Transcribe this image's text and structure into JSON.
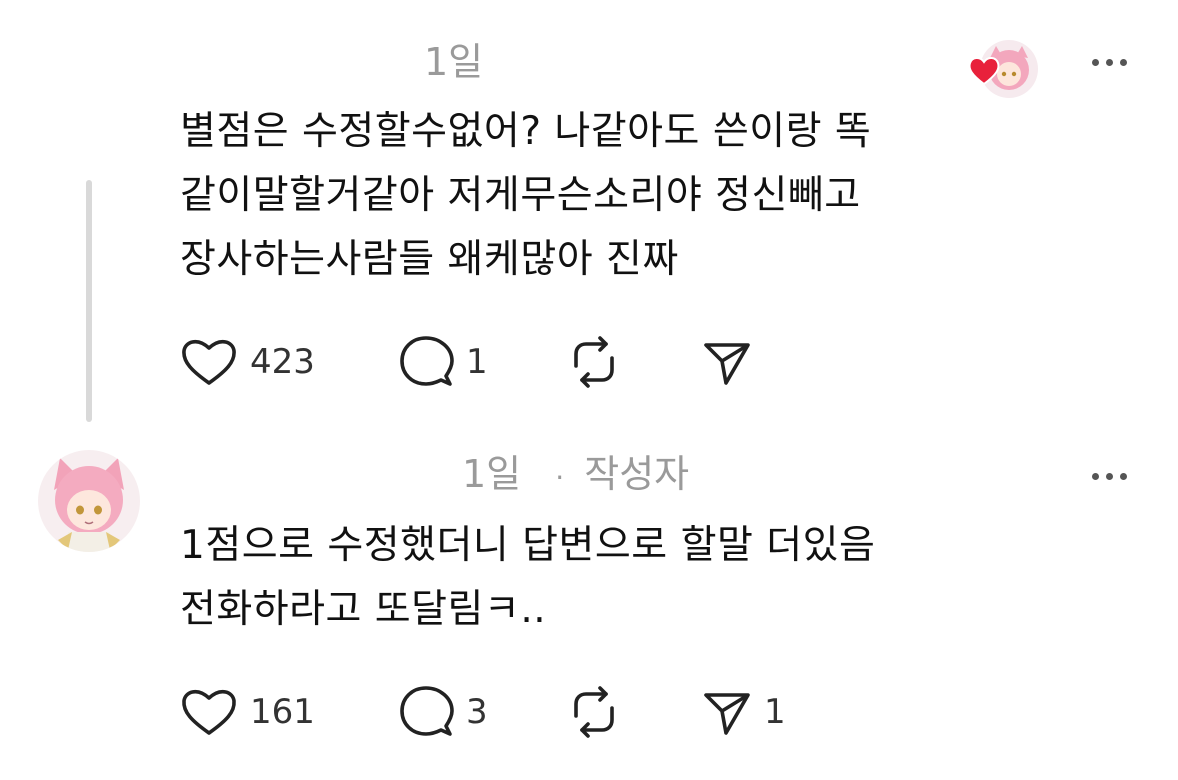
{
  "reply1": {
    "time": "1일",
    "text": "별점은 수정할수없어? 나같아도 쓴이랑 똑\n같이말할거같아 저게무슨소리야 정신빼고\n장사하는사람들 왜케많아 진짜",
    "likes": "423",
    "comments": "1",
    "liked_by_author": true,
    "heart_color": "#e8213b"
  },
  "reply2": {
    "time": "1일",
    "separator": "·",
    "author_badge": "작성자",
    "text": "1점으로 수정했더니 답변으로 할말 더있음\n전화하라고 또달림ㅋ..",
    "likes": "161",
    "comments": "3",
    "shares": "1"
  },
  "icons": [
    "heart-icon",
    "comment-icon",
    "repost-icon",
    "share-icon",
    "more-icon",
    "avatar"
  ]
}
